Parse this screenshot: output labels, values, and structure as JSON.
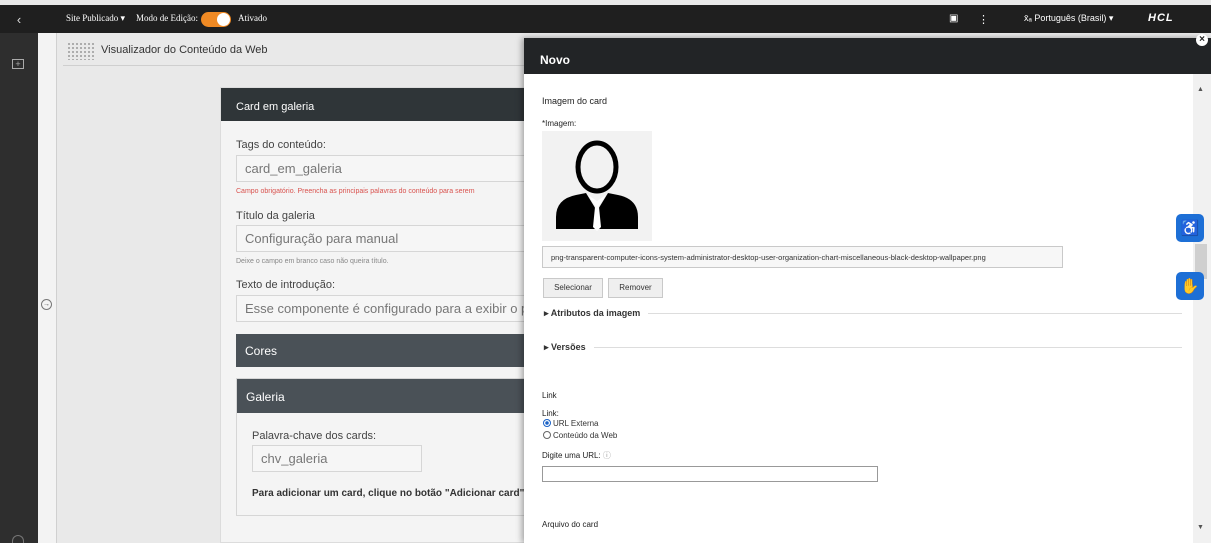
{
  "topbar": {
    "site_status": "Site Publicado",
    "edit_mode_label": "Modo de Edição:",
    "edit_mode_state": "Ativado",
    "language": "Português (Brasil)",
    "brand": "HCL"
  },
  "viewer": {
    "title": "Visualizador do Conteúdo da Web"
  },
  "card_form": {
    "header": "Card em galeria",
    "tags_label": "Tags do conteúdo:",
    "tags_value": "card_em_galeria",
    "tags_hint": "Campo obrigatório. Preencha as principais palavras do conteúdo para serem",
    "gallery_title_label": "Título da galeria",
    "gallery_title_value": "Configuração para manual",
    "gallery_title_hint": "Deixe o campo em branco caso não queira título.",
    "intro_label": "Texto de introdução:",
    "intro_value": "Esse componente é configurado para a exibir o pass",
    "section_colors": "Cores",
    "section_gallery": "Galeria",
    "keyword_label": "Palavra-chave dos cards:",
    "keyword_value": "chv_galeria",
    "add_card_note": "Para adicionar um card, clique no botão \"Adicionar card\""
  },
  "panel": {
    "title": "Novo",
    "card_image_heading": "Imagem do card",
    "image_label": "*Imagem:",
    "filename": "png-transparent-computer-icons-system-administrator-desktop-user-organization-chart-miscellaneous-black-desktop-wallpaper.png",
    "select_button": "Selecionar",
    "remove_button": "Remover",
    "image_attributes": "Atributos da imagem",
    "versions": "Versões",
    "link_heading": "Link",
    "link_label": "Link:",
    "radio_external": "URL Externa",
    "radio_web_content": "Conteúdo da Web",
    "url_label": "Digite uma URL:",
    "url_value": "",
    "card_file_heading": "Arquivo do card"
  },
  "colors": {
    "accent_toggle": "#f08a24",
    "side_button": "#1d6fd6"
  },
  "icons": [
    "chevron-left-icon",
    "translate-icon",
    "accessibility-icon",
    "sign-language-icon",
    "user-avatar-icon",
    "help-icon",
    "close-icon"
  ]
}
